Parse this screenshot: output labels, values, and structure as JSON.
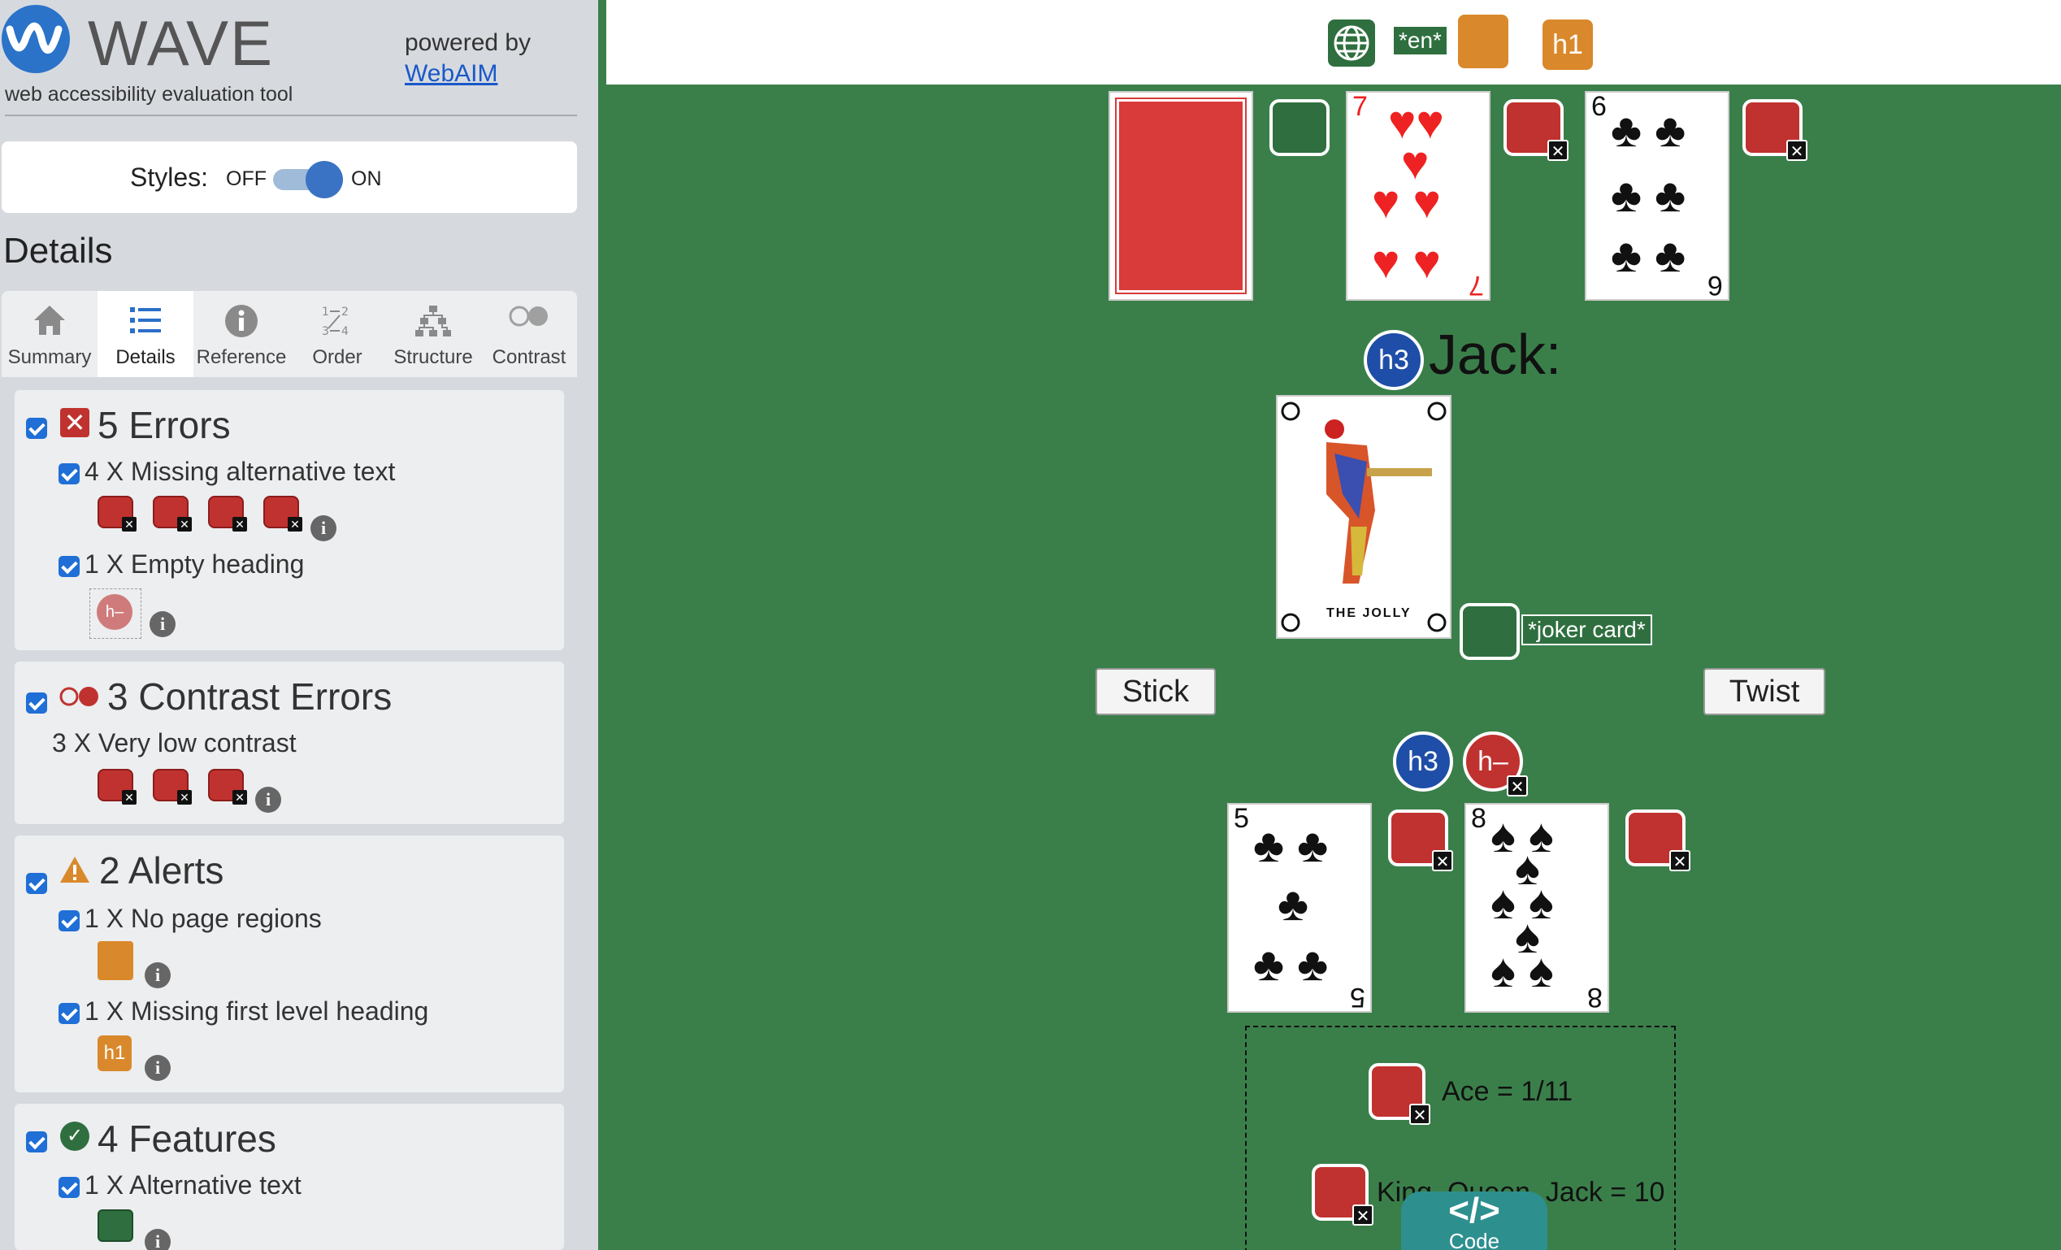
{
  "wave": {
    "title": "WAVE",
    "subtitle": "web accessibility evaluation tool",
    "powered_by": "powered by",
    "webaim": "WebAIM",
    "styles_label": "Styles:",
    "styles_off": "OFF",
    "styles_on": "ON",
    "details_heading": "Details",
    "tabs": [
      {
        "label": "Summary",
        "icon": "home-icon"
      },
      {
        "label": "Details",
        "icon": "list-icon"
      },
      {
        "label": "Reference",
        "icon": "info-icon"
      },
      {
        "label": "Order",
        "icon": "order-icon"
      },
      {
        "label": "Structure",
        "icon": "structure-icon"
      },
      {
        "label": "Contrast",
        "icon": "contrast-icon"
      }
    ],
    "errors": {
      "title": "5 Errors",
      "items": [
        "4 X Missing alternative text",
        "1 X Empty heading"
      ]
    },
    "contrast": {
      "title": "3 Contrast Errors",
      "items": [
        "3 X Very low contrast"
      ]
    },
    "alerts": {
      "title": "2 Alerts",
      "items": [
        "1 X No page regions",
        "1 X Missing first level heading"
      ]
    },
    "features": {
      "title": "4 Features",
      "items": [
        "1 X Alternative text"
      ]
    },
    "colors": {
      "accent": "#1f6fd6",
      "error": "#c0322f",
      "alert": "#d9892b",
      "feature": "#2f6f3f"
    }
  },
  "page": {
    "lang_tag": "*en*",
    "h1_icon": "h1",
    "dealer_heading": "Jack:",
    "h3": "h3",
    "h_empty": "h–",
    "joker_alt": "*joker card*",
    "joker_caption": "THE JOLLY",
    "stick_label": "Stick",
    "twist_label": "Twist",
    "dealer_cards": [
      {
        "rank": "7",
        "suit": "♥",
        "color": "red"
      },
      {
        "rank": "6",
        "suit": "♣",
        "color": "black"
      }
    ],
    "player_cards": [
      {
        "rank": "5",
        "suit": "♣",
        "color": "black"
      },
      {
        "rank": "8",
        "suit": "♠",
        "color": "black"
      }
    ],
    "rules": [
      "Ace = 1/11",
      "King, Queen, Jack = 10"
    ],
    "code_label": "Code",
    "code_icon": "</>"
  }
}
